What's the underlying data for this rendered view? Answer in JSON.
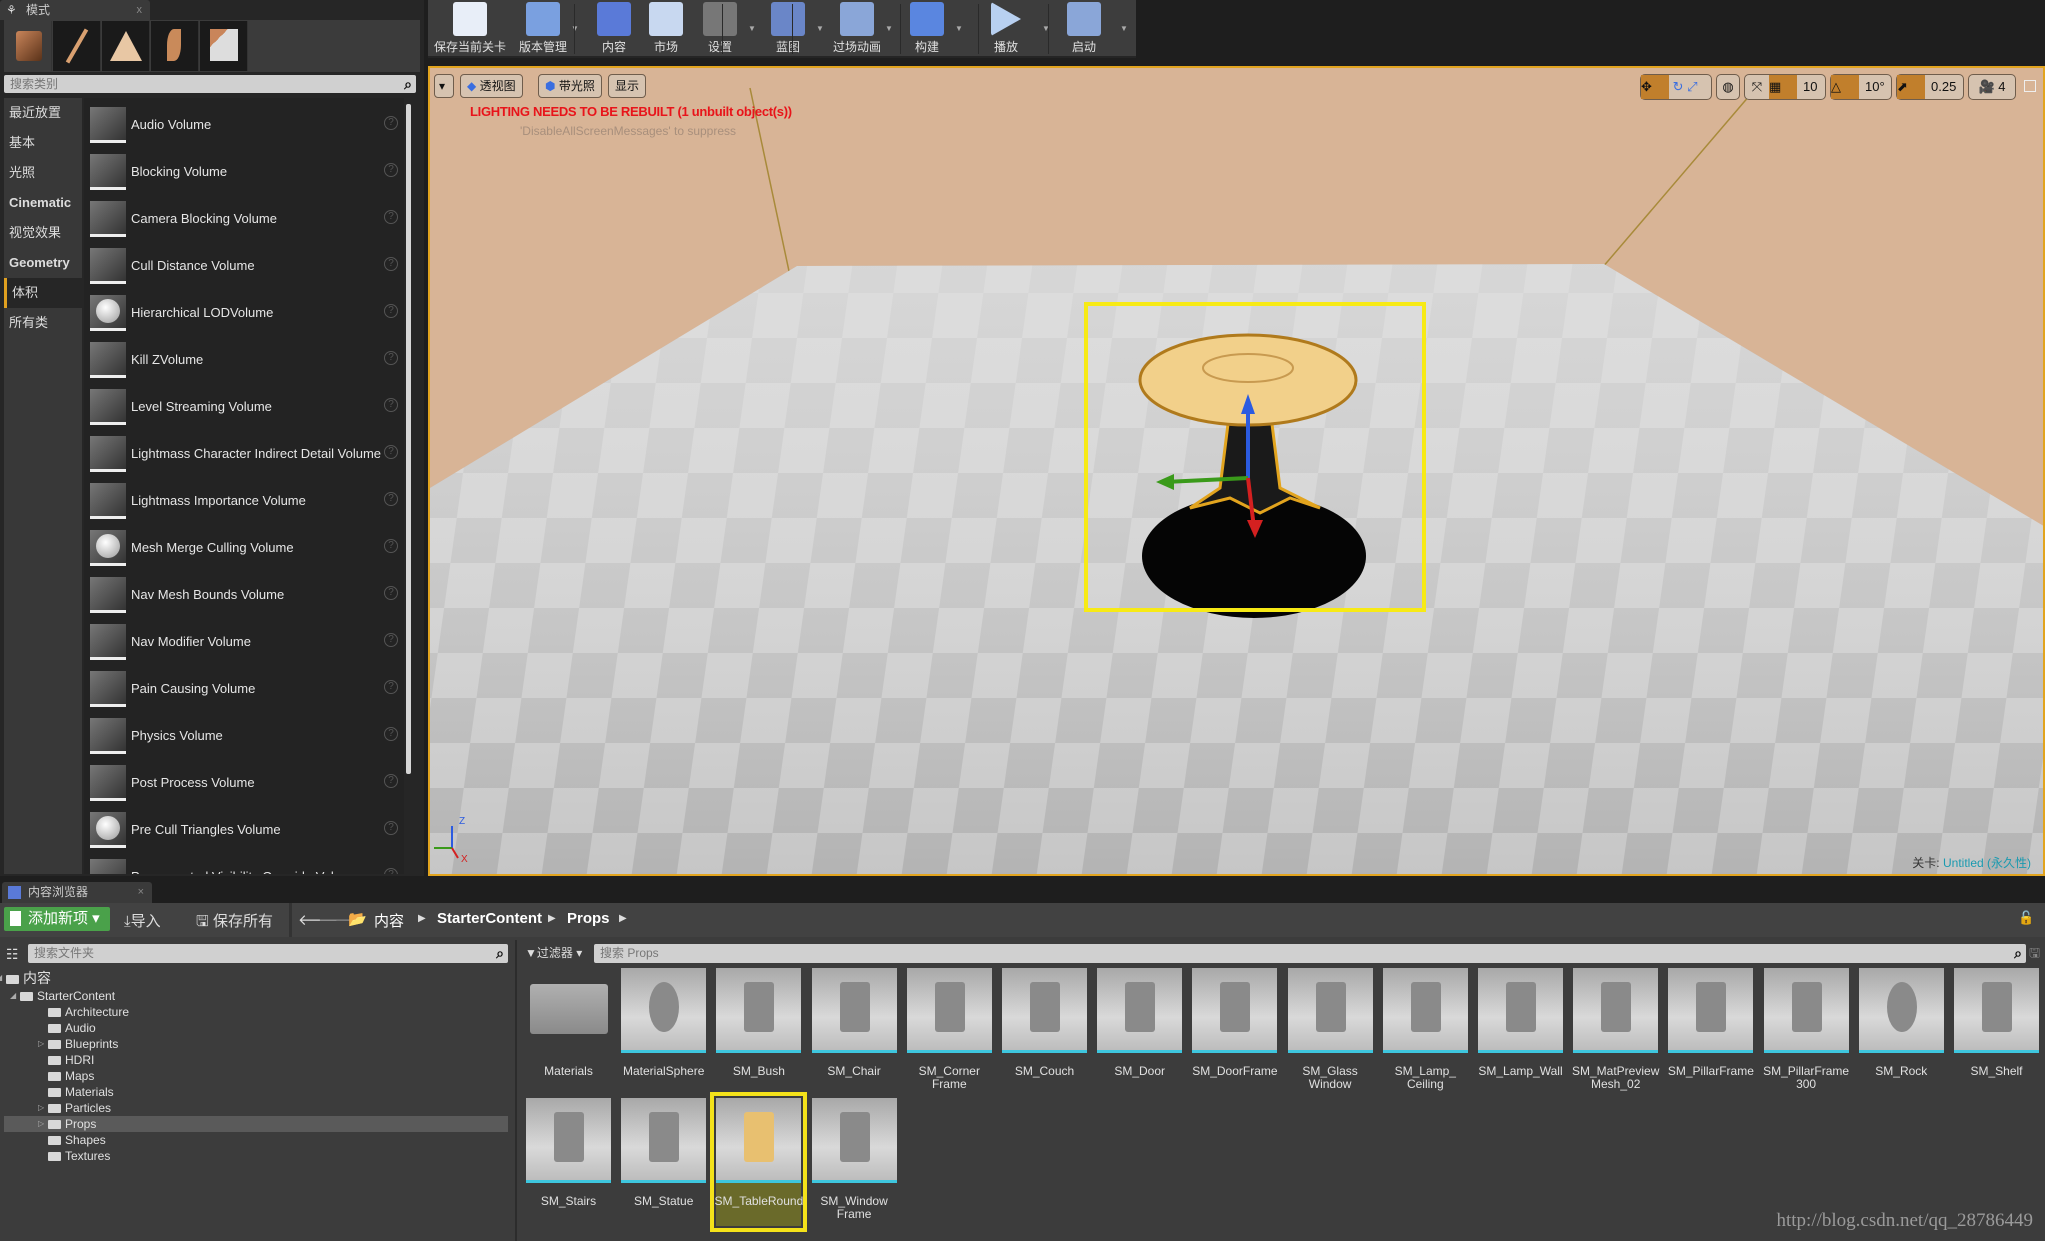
{
  "modes_panel": {
    "tab_title": "模式",
    "search_placeholder": "搜索类别",
    "categories": [
      "最近放置",
      "基本",
      "光照",
      "Cinematic",
      "视觉效果",
      "Geometry",
      "体积",
      "所有类"
    ],
    "selected_category": "体积",
    "items": [
      "Audio Volume",
      "Blocking Volume",
      "Camera Blocking Volume",
      "Cull Distance Volume",
      "Hierarchical LODVolume",
      "Kill ZVolume",
      "Level Streaming Volume",
      "Lightmass Character Indirect Detail Volume",
      "Lightmass Importance Volume",
      "Mesh Merge Culling Volume",
      "Nav Mesh Bounds Volume",
      "Nav Modifier Volume",
      "Pain Causing Volume",
      "Physics Volume",
      "Post Process Volume",
      "Pre Cull Triangles Volume",
      "Precomputed Visibility Override Volume"
    ]
  },
  "toolbar": {
    "buttons": [
      "保存当前关卡",
      "版本管理",
      "内容",
      "市场",
      "设置",
      "蓝图",
      "过场动画",
      "构建",
      "播放",
      "启动"
    ]
  },
  "viewport": {
    "perspective_label": "透视图",
    "lit_label": "带光照",
    "show_label": "显示",
    "warning": "LIGHTING NEEDS TO BE REBUILT (1 unbuilt object(s))",
    "suppress_hint": "'DisableAllScreenMessages' to suppress",
    "grid_snap": "10",
    "rotation_snap": "10°",
    "scale_snap": "0.25",
    "camera_speed": "4",
    "level_label": "关卡:",
    "level_name": "Untitled (永久性)",
    "axis_z": "Z",
    "axis_x": "X",
    "accent_color": "#e2a41e"
  },
  "content_browser": {
    "tab_title": "内容浏览器",
    "add_new": "添加新项",
    "import": "导入",
    "save_all": "保存所有",
    "breadcrumb": [
      "内容",
      "StarterContent",
      "Props"
    ],
    "folder_search_placeholder": "搜索文件夹",
    "filter_label": "过滤器",
    "asset_search_placeholder": "搜索 Props",
    "tree": [
      {
        "label": "内容",
        "depth": 0
      },
      {
        "label": "StarterContent",
        "depth": 1
      },
      {
        "label": "Architecture",
        "depth": 2
      },
      {
        "label": "Audio",
        "depth": 2
      },
      {
        "label": "Blueprints",
        "depth": 2
      },
      {
        "label": "HDRI",
        "depth": 2
      },
      {
        "label": "Maps",
        "depth": 2
      },
      {
        "label": "Materials",
        "depth": 2
      },
      {
        "label": "Particles",
        "depth": 2
      },
      {
        "label": "Props",
        "depth": 2,
        "selected": true
      },
      {
        "label": "Shapes",
        "depth": 2
      },
      {
        "label": "Textures",
        "depth": 2
      }
    ],
    "assets": [
      "Materials",
      "MaterialSphere",
      "SM_Bush",
      "SM_Chair",
      "SM_Corner Frame",
      "SM_Couch",
      "SM_Door",
      "SM_DoorFrame",
      "SM_Glass Window",
      "SM_Lamp_ Ceiling",
      "SM_Lamp_Wall",
      "SM_MatPreview Mesh_02",
      "SM_PillarFrame",
      "SM_PillarFrame 300",
      "SM_Rock",
      "SM_Shelf",
      "SM_Stairs",
      "SM_Statue",
      "SM_TableRound",
      "SM_Window Frame"
    ],
    "selected_asset": "SM_TableRound"
  },
  "watermark": "http://blog.csdn.net/qq_28786449"
}
